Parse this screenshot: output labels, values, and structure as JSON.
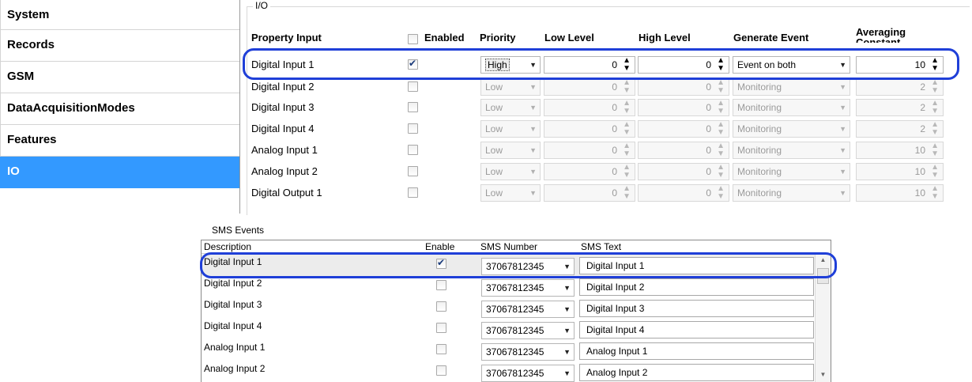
{
  "sidebar": {
    "items": [
      {
        "label": "System"
      },
      {
        "label": "Records"
      },
      {
        "label": "GSM"
      },
      {
        "label": "DataAcquisitionModes"
      },
      {
        "label": "Features"
      },
      {
        "label": "IO"
      }
    ],
    "active": "IO",
    "accent": "#3399ff"
  },
  "io": {
    "legend": "I/O",
    "headers": {
      "property": "Property Input",
      "enabled": "Enabled",
      "priority": "Priority",
      "low": "Low Level",
      "high": "High Level",
      "event": "Generate Event",
      "averaging": "Averaging Constant"
    },
    "rows": [
      {
        "name": "Digital Input 1",
        "enabled": true,
        "priority": "High",
        "low": "0",
        "high": "0",
        "event": "Event on both",
        "avg": "10"
      },
      {
        "name": "Digital Input 2",
        "enabled": false,
        "priority": "Low",
        "low": "0",
        "high": "0",
        "event": "Monitoring",
        "avg": "2"
      },
      {
        "name": "Digital Input 3",
        "enabled": false,
        "priority": "Low",
        "low": "0",
        "high": "0",
        "event": "Monitoring",
        "avg": "2"
      },
      {
        "name": "Digital Input 4",
        "enabled": false,
        "priority": "Low",
        "low": "0",
        "high": "0",
        "event": "Monitoring",
        "avg": "2"
      },
      {
        "name": "Analog Input 1",
        "enabled": false,
        "priority": "Low",
        "low": "0",
        "high": "0",
        "event": "Monitoring",
        "avg": "10"
      },
      {
        "name": "Analog Input 2",
        "enabled": false,
        "priority": "Low",
        "low": "0",
        "high": "0",
        "event": "Monitoring",
        "avg": "10"
      },
      {
        "name": "Digital Output 1",
        "enabled": false,
        "priority": "Low",
        "low": "0",
        "high": "0",
        "event": "Monitoring",
        "avg": "10"
      }
    ]
  },
  "sms": {
    "title": "SMS Events",
    "headers": {
      "description": "Description",
      "enable": "Enable",
      "number": "SMS Number",
      "text": "SMS Text"
    },
    "rows": [
      {
        "description": "Digital Input 1",
        "enabled": true,
        "number": "37067812345",
        "text": "Digital Input 1"
      },
      {
        "description": "Digital Input 2",
        "enabled": false,
        "number": "37067812345",
        "text": "Digital Input 2"
      },
      {
        "description": "Digital Input 3",
        "enabled": false,
        "number": "37067812345",
        "text": "Digital Input 3"
      },
      {
        "description": "Digital Input 4",
        "enabled": false,
        "number": "37067812345",
        "text": "Digital Input 4"
      },
      {
        "description": "Analog Input 1",
        "enabled": false,
        "number": "37067812345",
        "text": "Analog Input 1"
      },
      {
        "description": "Analog Input 2",
        "enabled": false,
        "number": "37067812345",
        "text": "Analog Input 2"
      }
    ]
  },
  "colors": {
    "highlight": "#1f3fd8",
    "selected_row": "#ececec"
  }
}
